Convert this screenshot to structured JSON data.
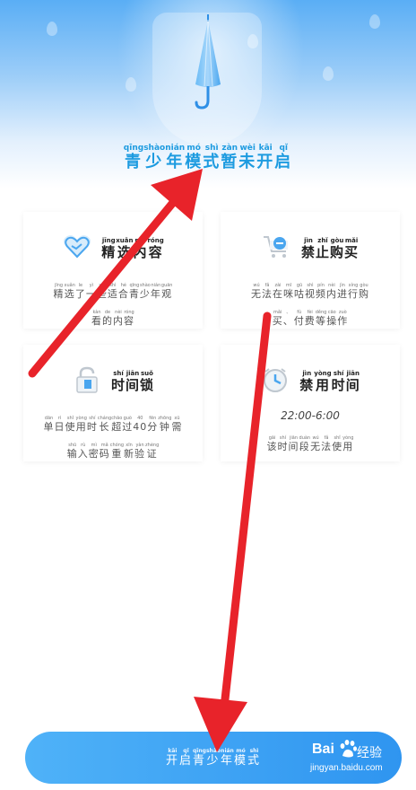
{
  "hero": {
    "title": [
      {
        "py": "qīng",
        "hz": "青"
      },
      {
        "py": "shào",
        "hz": "少"
      },
      {
        "py": "nián",
        "hz": "年"
      },
      {
        "py": "mó",
        "hz": "模"
      },
      {
        "py": "shì",
        "hz": "式"
      },
      {
        "py": "zàn",
        "hz": "暂"
      },
      {
        "py": "wèi",
        "hz": "未"
      },
      {
        "py": "kāi",
        "hz": "开"
      },
      {
        "py": "qǐ",
        "hz": "启"
      }
    ]
  },
  "cards": [
    {
      "icon": "heart-icon",
      "title": [
        {
          "py": "jīng",
          "hz": "精"
        },
        {
          "py": "xuǎn",
          "hz": "选"
        },
        {
          "py": "nèi",
          "hz": "内"
        },
        {
          "py": "róng",
          "hz": "容"
        }
      ],
      "desc1": [
        {
          "py": "jīng",
          "hz": "精"
        },
        {
          "py": "xuǎn",
          "hz": "选"
        },
        {
          "py": "le",
          "hz": "了"
        },
        {
          "py": "yì",
          "hz": "一"
        },
        {
          "py": "xiē",
          "hz": "些"
        },
        {
          "py": "shì",
          "hz": "适"
        },
        {
          "py": "hé",
          "hz": "合"
        },
        {
          "py": "qīng",
          "hz": "青"
        },
        {
          "py": "shào",
          "hz": "少"
        },
        {
          "py": "nián",
          "hz": "年"
        },
        {
          "py": "guān",
          "hz": "观"
        }
      ],
      "desc2": [
        {
          "py": "kàn",
          "hz": "看"
        },
        {
          "py": "de",
          "hz": "的"
        },
        {
          "py": "nèi",
          "hz": "内"
        },
        {
          "py": "róng",
          "hz": "容"
        }
      ]
    },
    {
      "icon": "cart-icon",
      "title": [
        {
          "py": "jìn",
          "hz": "禁"
        },
        {
          "py": "zhǐ",
          "hz": "止"
        },
        {
          "py": "gòu",
          "hz": "购"
        },
        {
          "py": "mǎi",
          "hz": "买"
        }
      ],
      "desc1": [
        {
          "py": "wú",
          "hz": "无"
        },
        {
          "py": "fǎ",
          "hz": "法"
        },
        {
          "py": "zài",
          "hz": "在"
        },
        {
          "py": "mī",
          "hz": "咪"
        },
        {
          "py": "gū",
          "hz": "咕"
        },
        {
          "py": "shì",
          "hz": "视"
        },
        {
          "py": "pín",
          "hz": "频"
        },
        {
          "py": "nèi",
          "hz": "内"
        },
        {
          "py": "jìn",
          "hz": "进"
        },
        {
          "py": "xíng",
          "hz": "行"
        },
        {
          "py": "gòu",
          "hz": "购"
        }
      ],
      "desc2": [
        {
          "py": "mǎi",
          "hz": "买"
        },
        {
          "py": "、",
          "hz": "、"
        },
        {
          "py": "fù",
          "hz": "付"
        },
        {
          "py": "fèi",
          "hz": "费"
        },
        {
          "py": "děng",
          "hz": "等"
        },
        {
          "py": "cāo",
          "hz": "操"
        },
        {
          "py": "zuò",
          "hz": "作"
        }
      ]
    },
    {
      "icon": "lock-icon",
      "title": [
        {
          "py": "shí",
          "hz": "时"
        },
        {
          "py": "jiān",
          "hz": "间"
        },
        {
          "py": "suǒ",
          "hz": "锁"
        }
      ],
      "desc1": [
        {
          "py": "dān",
          "hz": "单"
        },
        {
          "py": "rì",
          "hz": "日"
        },
        {
          "py": "shǐ",
          "hz": "使"
        },
        {
          "py": "yòng",
          "hz": "用"
        },
        {
          "py": "shí",
          "hz": "时"
        },
        {
          "py": "cháng",
          "hz": "长"
        },
        {
          "py": "chāo",
          "hz": "超"
        },
        {
          "py": "guò",
          "hz": "过"
        },
        {
          "py": "40",
          "hz": "40"
        },
        {
          "py": "fēn",
          "hz": "分"
        },
        {
          "py": "zhōng",
          "hz": "钟"
        },
        {
          "py": "xū",
          "hz": "需"
        }
      ],
      "desc2": [
        {
          "py": "shū",
          "hz": "输"
        },
        {
          "py": "rù",
          "hz": "入"
        },
        {
          "py": "mì",
          "hz": "密"
        },
        {
          "py": "mǎ",
          "hz": "码"
        },
        {
          "py": "chóng",
          "hz": "重"
        },
        {
          "py": "xīn",
          "hz": "新"
        },
        {
          "py": "yàn",
          "hz": "验"
        },
        {
          "py": "zhèng",
          "hz": "证"
        }
      ]
    },
    {
      "icon": "clock-icon",
      "title": [
        {
          "py": "jìn",
          "hz": "禁"
        },
        {
          "py": "yòng",
          "hz": "用"
        },
        {
          "py": "shí",
          "hz": "时"
        },
        {
          "py": "jiān",
          "hz": "间"
        }
      ],
      "time": "22:00-6:00",
      "desc2": [
        {
          "py": "gāi",
          "hz": "该"
        },
        {
          "py": "shí",
          "hz": "时"
        },
        {
          "py": "jiān",
          "hz": "间"
        },
        {
          "py": "duàn",
          "hz": "段"
        },
        {
          "py": "wú",
          "hz": "无"
        },
        {
          "py": "fǎ",
          "hz": "法"
        },
        {
          "py": "shǐ",
          "hz": "使"
        },
        {
          "py": "yòng",
          "hz": "用"
        }
      ]
    }
  ],
  "button": {
    "label": [
      {
        "py": "kāi",
        "hz": "开"
      },
      {
        "py": "qǐ",
        "hz": "启"
      },
      {
        "py": "qīng",
        "hz": "青"
      },
      {
        "py": "shào",
        "hz": "少"
      },
      {
        "py": "nián",
        "hz": "年"
      },
      {
        "py": "mó",
        "hz": "模"
      },
      {
        "py": "shì",
        "hz": "式"
      }
    ]
  },
  "watermark": {
    "brand": "Bai",
    "cn": "经验",
    "url": "jingyan.baidu.com"
  },
  "colors": {
    "accent": "#1d9be0",
    "button": "#3ba3f4",
    "arrow": "#e8232a"
  }
}
